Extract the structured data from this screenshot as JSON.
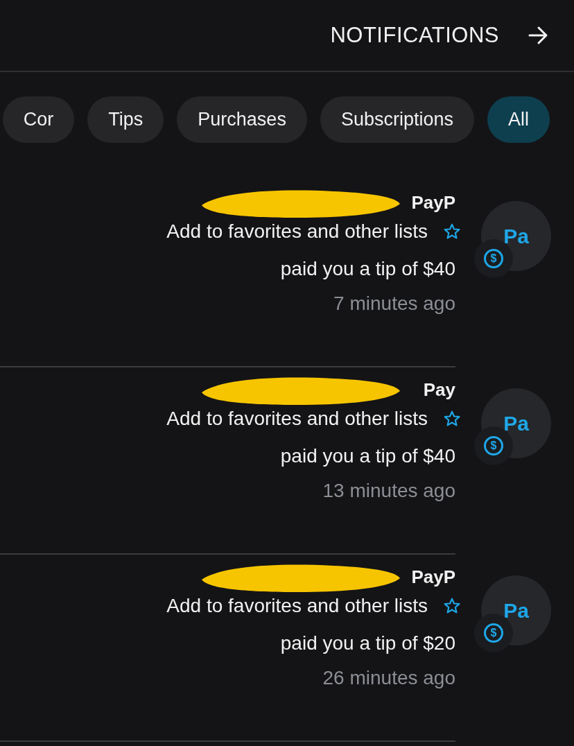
{
  "header": {
    "title": "NOTIFICATIONS"
  },
  "tabs": [
    {
      "label": "Cor",
      "selected": false
    },
    {
      "label": "Tips",
      "selected": false
    },
    {
      "label": "Purchases",
      "selected": false
    },
    {
      "label": "Subscriptions",
      "selected": false
    },
    {
      "label": "All",
      "selected": true
    }
  ],
  "notifications": [
    {
      "avatar": "Pa",
      "badge": "$",
      "name": "PayP",
      "redacted": true,
      "action": "Add to favorites and other lists",
      "message": "paid you a tip of $40",
      "time": "7 minutes ago"
    },
    {
      "avatar": "Pa",
      "badge": "$",
      "name": "Pay",
      "redacted": true,
      "action": "Add to favorites and other lists",
      "message": "paid you a tip of $40",
      "time": "13 minutes ago"
    },
    {
      "avatar": "Pa",
      "badge": "$",
      "name": "PayP",
      "redacted": true,
      "action": "Add to favorites and other lists",
      "message": "paid you a tip of $20",
      "time": "26 minutes ago"
    }
  ]
}
